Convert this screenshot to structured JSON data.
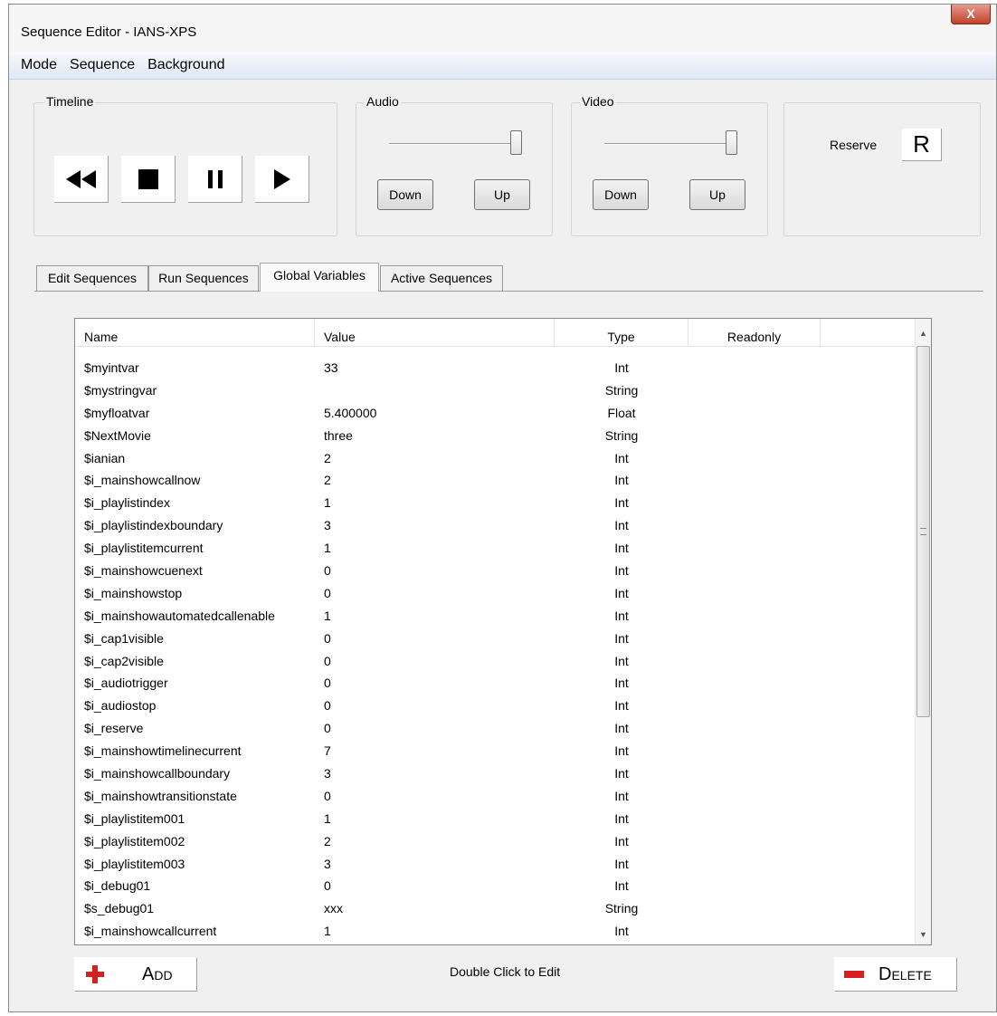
{
  "window": {
    "title": "Sequence Editor - IANS-XPS",
    "close_glyph": "X"
  },
  "menu": [
    "Mode",
    "Sequence",
    "Background"
  ],
  "timeline": {
    "label": "Timeline",
    "buttons": [
      "rewind-icon",
      "stop-icon",
      "pause-icon",
      "play-icon"
    ]
  },
  "audio": {
    "label": "Audio",
    "volume": 1.0,
    "down_label": "Down",
    "up_label": "Up"
  },
  "video": {
    "label": "Video",
    "volume": 1.0,
    "down_label": "Down",
    "up_label": "Up"
  },
  "reserve": {
    "label": "Reserve",
    "button": "R"
  },
  "tabs": [
    {
      "label": "Edit Sequences",
      "active": false
    },
    {
      "label": "Run Sequences",
      "active": false
    },
    {
      "label": "Global Variables",
      "active": true
    },
    {
      "label": "Active Sequences",
      "active": false
    }
  ],
  "table": {
    "headers": [
      "Name",
      "Value",
      "Type",
      "Readonly"
    ],
    "rows": [
      [
        "$myintvar",
        "33",
        "Int",
        ""
      ],
      [
        "$mystringvar",
        "",
        "String",
        ""
      ],
      [
        "$myfloatvar",
        "5.400000",
        "Float",
        ""
      ],
      [
        "$NextMovie",
        "three",
        "String",
        ""
      ],
      [
        "$ianian",
        "2",
        "Int",
        ""
      ],
      [
        "$i_mainshowcallnow",
        "2",
        "Int",
        ""
      ],
      [
        "$i_playlistindex",
        "1",
        "Int",
        ""
      ],
      [
        "$i_playlistindexboundary",
        "3",
        "Int",
        ""
      ],
      [
        "$i_playlistitemcurrent",
        "1",
        "Int",
        ""
      ],
      [
        "$i_mainshowcuenext",
        "0",
        "Int",
        ""
      ],
      [
        "$i_mainshowstop",
        "0",
        "Int",
        ""
      ],
      [
        "$i_mainshowautomatedcallenable",
        "1",
        "Int",
        ""
      ],
      [
        "$i_cap1visible",
        "0",
        "Int",
        ""
      ],
      [
        "$i_cap2visible",
        "0",
        "Int",
        ""
      ],
      [
        "$i_audiotrigger",
        "0",
        "Int",
        ""
      ],
      [
        "$i_audiostop",
        "0",
        "Int",
        ""
      ],
      [
        "$i_reserve",
        "0",
        "Int",
        ""
      ],
      [
        "$i_mainshowtimelinecurrent",
        "7",
        "Int",
        ""
      ],
      [
        "$i_mainshowcallboundary",
        "3",
        "Int",
        ""
      ],
      [
        "$i_mainshowtransitionstate",
        "0",
        "Int",
        ""
      ],
      [
        "$i_playlistitem001",
        "1",
        "Int",
        ""
      ],
      [
        "$i_playlistitem002",
        "2",
        "Int",
        ""
      ],
      [
        "$i_playlistitem003",
        "3",
        "Int",
        ""
      ],
      [
        "$i_debug01",
        "0",
        "Int",
        ""
      ],
      [
        "$s_debug01",
        "xxx",
        "String",
        ""
      ],
      [
        "$i_mainshowcallcurrent",
        "1",
        "Int",
        ""
      ]
    ]
  },
  "footer": {
    "add_label": "Add",
    "delete_label": "Delete",
    "hint": "Double Click to Edit"
  },
  "colors": {
    "add_icon": "#d42020",
    "delete_icon": "#d42020",
    "menubar": "#dfe8f5"
  }
}
